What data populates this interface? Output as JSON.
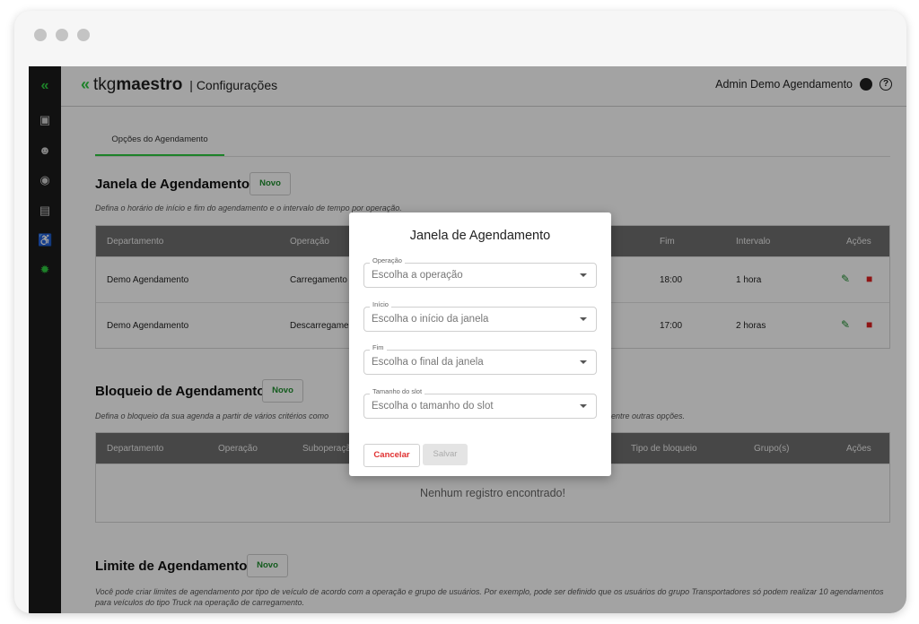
{
  "brand": {
    "part1": "tkg",
    "part2": "maestro",
    "section": "| Configurações"
  },
  "user": {
    "name": "Admin Demo Agendamento"
  },
  "tabs": [
    {
      "label": "Opções do Agendamento"
    }
  ],
  "janela": {
    "title": "Janela de Agendamento",
    "novo": "Novo",
    "description": "Defina o horário de início e fim do agendamento e o intervalo de tempo por operação.",
    "columns": [
      "Departamento",
      "Operação",
      "Fim",
      "Intervalo",
      "Ações"
    ],
    "rows": [
      {
        "departamento": "Demo Agendamento",
        "operacao": "Carregamento",
        "fim": "18:00",
        "intervalo": "1 hora"
      },
      {
        "departamento": "Demo Agendamento",
        "operacao": "Descarregamento",
        "fim": "17:00",
        "intervalo": "2 horas"
      }
    ]
  },
  "bloqueio": {
    "title": "Bloqueio de Agendamento",
    "novo": "Novo",
    "description": "Defina o bloqueio da sua agenda a partir de vários critérios como",
    "description_end": "entre outras opções.",
    "columns": [
      "Departamento",
      "Operação",
      "Suboperação",
      "Tipo de bloqueio",
      "Grupo(s)",
      "Ações"
    ],
    "empty": "Nenhum registro encontrado!"
  },
  "limite": {
    "title": "Limite de Agendamento",
    "novo": "Novo",
    "description": "Você pode criar limites de agendamento por tipo de veículo de acordo com a operação e grupo de usuários. Por exemplo, pode ser definido que os usuários do grupo Transportadores só podem realizar 10 agendamentos para veículos do tipo Truck na operação de carregamento."
  },
  "modal": {
    "title": "Janela de Agendamento",
    "fields": [
      {
        "label": "Operação",
        "placeholder": "Escolha a operação"
      },
      {
        "label": "Início",
        "placeholder": "Escolha o início da janela"
      },
      {
        "label": "Fim",
        "placeholder": "Escolha o final da janela"
      },
      {
        "label": "Tamanho do slot",
        "placeholder": "Escolha o tamanho do slot"
      }
    ],
    "cancel": "Cancelar",
    "save": "Salvar"
  },
  "colors": {
    "accent": "#2ecc40",
    "danger": "#e02020",
    "header": "#6f6f6f"
  }
}
